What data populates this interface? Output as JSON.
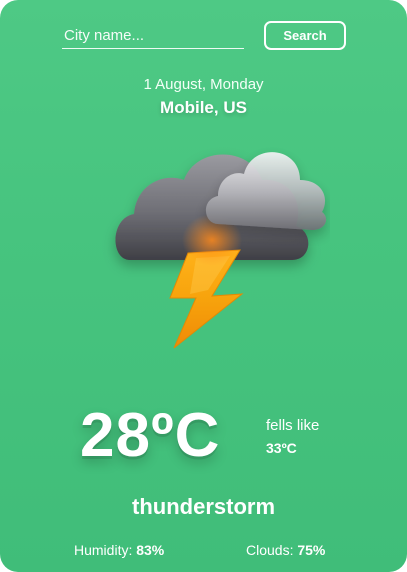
{
  "search": {
    "placeholder": "City name...",
    "button_label": "Search"
  },
  "header": {
    "date": "1 August, Monday",
    "location": "Mobile, US"
  },
  "weather": {
    "icon": "thunderstorm-icon",
    "temperature": "28ºC",
    "feels_like_label": "fells like",
    "feels_like_value": "33ºC",
    "condition": "thunderstorm"
  },
  "stats": {
    "humidity_label": "Humidity:",
    "humidity_value": "83%",
    "clouds_label": "Clouds:",
    "clouds_value": "75%"
  },
  "colors": {
    "background": "#47c47f",
    "text": "#ffffff",
    "bolt": "#f7b114"
  }
}
